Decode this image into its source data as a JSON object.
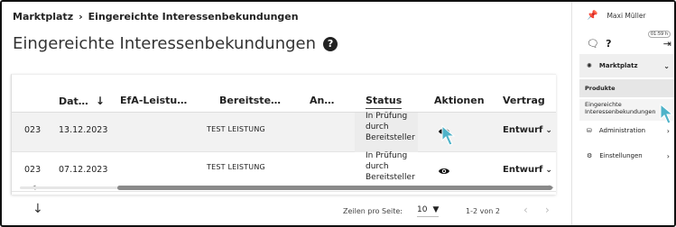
{
  "breadcrumb": {
    "root": "Marktplatz",
    "separator": "›",
    "current": "Eingereichte Interessenbekundungen"
  },
  "page": {
    "title": "Eingereichte Interessenbekundungen",
    "help_icon": "?"
  },
  "table": {
    "headers": {
      "date": "Dat…",
      "sort_icon": "↓",
      "efa": "EfA-Leistu…",
      "bereitsteller": "Bereitste…",
      "an": "An…",
      "status": "Status",
      "aktionen": "Aktionen",
      "vertrag": "Vertrag"
    },
    "rows": [
      {
        "year_fragment": "023",
        "date": "13.12.2023",
        "leistung": "TEST LEISTUNG",
        "status": "In Prüfung durch Bereitsteller",
        "vertrag": "Entwurf"
      },
      {
        "year_fragment": "023",
        "date": "07.12.2023",
        "leistung": "TEST LEISTUNG",
        "status": "In Prüfung durch Bereitsteller",
        "vertrag": "Entwurf"
      }
    ]
  },
  "footer": {
    "rows_per_page_label": "Zeilen pro Seite:",
    "rows_per_page_value": "10",
    "range": "1-2 von 2",
    "prev": "‹",
    "next": "›",
    "down_arrow": "↓"
  },
  "sidebar": {
    "user_name": "Maxi Müller",
    "timer": "01:59 h",
    "nav_marktplatz": "Marktplatz",
    "sub_produkte": "Produkte",
    "sub_eingereicht": "Eingereichte Interessenbekundungen",
    "nav_admin": "Administration",
    "nav_settings": "Einstellungen"
  },
  "colors": {
    "cursor": "#4fb3c9",
    "accent_dark": "#1f1f1f",
    "row_highlight": "#f2f2f2"
  }
}
